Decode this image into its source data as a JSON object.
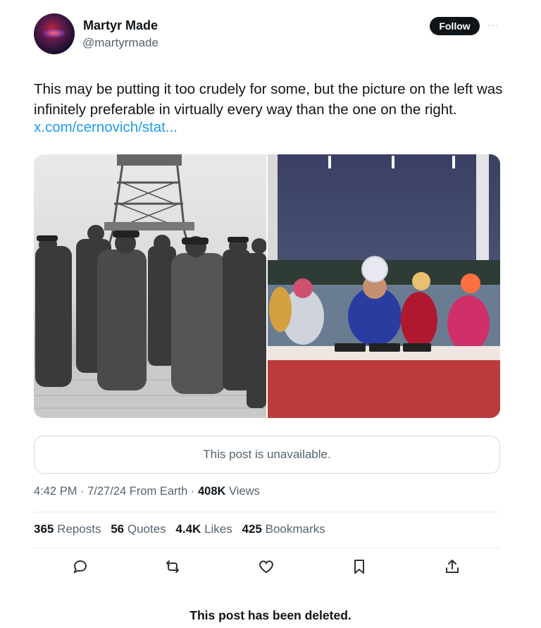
{
  "author": {
    "name": "Martyr Made",
    "handle": "@martyrmade",
    "follow_label": "Follow",
    "more_label": "···"
  },
  "tweet": {
    "text": "This may be putting it too crudely for some, but the picture on the left was infinitely preferable in virtually every way than the one on the right.",
    "link": "x.com/cernovich/stat..."
  },
  "media": {
    "left_image": "black-and-white photo of uniformed officers walking in front of the Eiffel Tower",
    "right_image": "color photo of costumed performers seated behind a long table on a stage"
  },
  "quoted_post": {
    "status": "This post is unavailable."
  },
  "meta": {
    "time": "4:42 PM",
    "date": "7/27/24",
    "source": "From Earth",
    "views_count": "408K",
    "views_label": "Views"
  },
  "stats": {
    "reposts_count": "365",
    "reposts_label": "Reposts",
    "quotes_count": "56",
    "quotes_label": "Quotes",
    "likes_count": "4.4K",
    "likes_label": "Likes",
    "bookmarks_count": "425",
    "bookmarks_label": "Bookmarks"
  },
  "actions": [
    "reply-icon",
    "repost-icon",
    "like-icon",
    "bookmark-icon",
    "share-icon"
  ],
  "footer": {
    "deleted_notice": "This post has been deleted."
  },
  "colors": {
    "link": "#1d9bf0",
    "text": "#0f1419",
    "secondary": "#536471",
    "border": "#cfd9de"
  }
}
